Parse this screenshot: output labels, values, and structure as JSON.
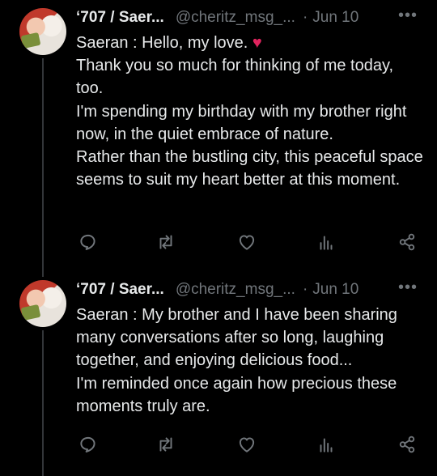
{
  "tweets": [
    {
      "display_name": "‘707 / Saer...",
      "handle": "@cheritz_msg_...",
      "separator": "·",
      "date": "Jun 10",
      "more": "•••",
      "lines": [
        "Saeran : Hello, my love.",
        "Thank you so much for thinking of me today, too.",
        "I'm spending my birthday with my brother right now, in the quiet embrace of nature.",
        "Rather than the bustling city, this peaceful space seems to suit my heart better at this moment."
      ],
      "heart": "♥"
    },
    {
      "display_name": "‘707 / Saer...",
      "handle": "@cheritz_msg_...",
      "separator": "·",
      "date": "Jun 10",
      "more": "•••",
      "lines": [
        "Saeran : My brother and I have been sharing many conversations after so long, laughing together, and enjoying delicious food...",
        "I'm reminded once again how precious these moments truly are."
      ]
    }
  ],
  "icons": [
    "reply-icon",
    "retweet-icon",
    "like-icon",
    "views-icon",
    "share-icon"
  ],
  "colors": {
    "text": "#e7e9ea",
    "muted": "#71767b",
    "heart": "#e0245e",
    "background": "#000000"
  }
}
